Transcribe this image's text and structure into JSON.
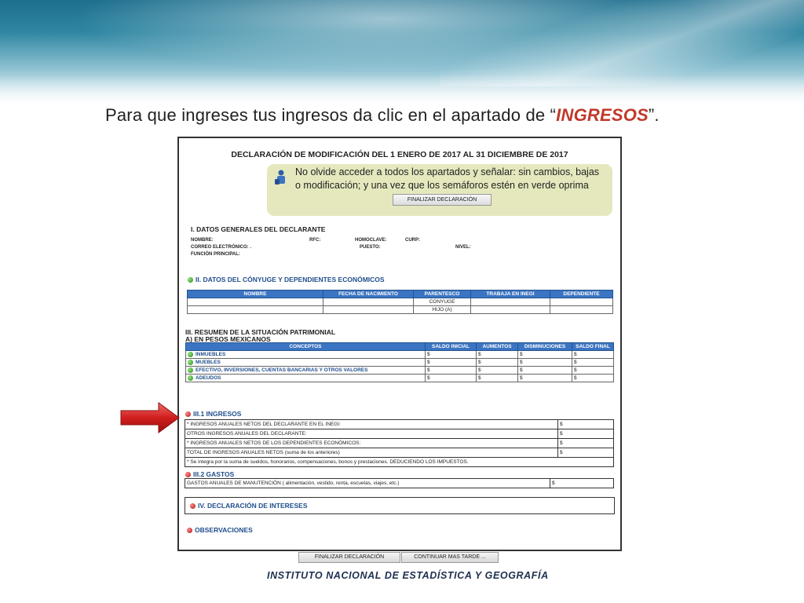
{
  "heading": {
    "prefix": "Para que ingreses tus ingresos da clic en el apartado de “",
    "keyword": "INGRESOS",
    "suffix": "”."
  },
  "form": {
    "title": "DECLARACIÓN DE MODIFICACIÓN DEL 1 ENERO DE 2017 AL 31 DICIEMBRE DE 2017",
    "notice": {
      "line1": "No olvide acceder a todos los apartados y señalar: sin cambios, bajas",
      "line2": "o modificación; y una vez que los semáforos estén en verde oprima",
      "button": "FINALIZAR DECLARACIÓN"
    },
    "general": {
      "title": "I. DATOS GENERALES DEL DECLARANTE",
      "nombre": "NOMBRE:",
      "rfc": "RFC:",
      "homoclave": "HOMOCLAVE:",
      "curp": "CURP:",
      "correo": "CORREO ELECTRÓNICO: .",
      "puesto": "PUESTO:",
      "nivel": "NIVEL:",
      "funcion": "FUNCIÓN PRINCIPAL:"
    },
    "conyuge": {
      "title": "II. DATOS DEL CÓNYUGE Y DEPENDIENTES ECONÓMICOS",
      "headers": [
        "NOMBRE",
        "FECHA DE NACIMIENTO",
        "PARENTESCO",
        "TRABAJA EN INEGI",
        "DEPENDIENTE"
      ],
      "rows": [
        [
          "",
          "",
          "CONYUGE",
          "",
          ""
        ],
        [
          "",
          "",
          "HIJO (A)",
          "",
          ""
        ]
      ]
    },
    "resumen": {
      "title": "III. RESUMEN DE LA SITUACIÓN PATRIMONIAL",
      "subtitle": "A) EN PESOS MEXICANOS",
      "headers": [
        "CONCEPTOS",
        "SALDO INICIAL",
        "AUMENTOS",
        "DISMINUCIONES",
        "SALDO FINAL"
      ],
      "currency": "$",
      "rows": [
        {
          "label": "INMUEBLES"
        },
        {
          "label": "MUEBLES"
        },
        {
          "label": "EFECTIVO, INVERSIONES, CUENTAS BANCARIAS Y OTROS VALORES"
        },
        {
          "label": "ADEUDOS"
        }
      ]
    },
    "ingresos": {
      "title": "III.1 INGRESOS",
      "rows": [
        "* INGRESOS ANUALES NETOS DEL DECLARANTE EN EL INEGI:",
        "OTROS INGRESOS ANUALES DEL DECLARANTE:",
        "* INGRESOS ANUALES NETOS DE LOS DEPENDIENTES ECONÓMICOS:",
        "TOTAL DE INGRESOS ANUALES NETOS (suma de los anteriores)"
      ],
      "currency": "$",
      "note": "* Se integra por la suma de sueldos, honorarios, compensaciones, bonos y prestaciones. DEDUCIENDO LOS IMPUESTOS."
    },
    "gastos": {
      "title": "III.2 GASTOS",
      "row": "GASTOS ANUALES DE MANUTENCIÓN ( alimentación, vestido, renta, escuelas, viajes, etc.)",
      "currency": "$"
    },
    "intereses": {
      "title": "IV. DECLARACIÓN DE INTERESES"
    },
    "observaciones": {
      "title": "OBSERVACIONES"
    }
  },
  "footer_buttons": {
    "finalizar": "FINALIZAR DECLARACIÓN",
    "continuar": "CONTINUAR MAS TARDE ..."
  },
  "footer": {
    "institution": "INSTITUTO NACIONAL  DE ESTADÍSTICA Y GEOGRAFÍA"
  },
  "colors": {
    "accent_red": "#c0392b",
    "table_header": "#3b74c2",
    "link_blue": "#1f4e8c",
    "notice_bg": "#e5e8bd",
    "status_green": "#1e8a1a",
    "status_red": "#b10f0f"
  }
}
